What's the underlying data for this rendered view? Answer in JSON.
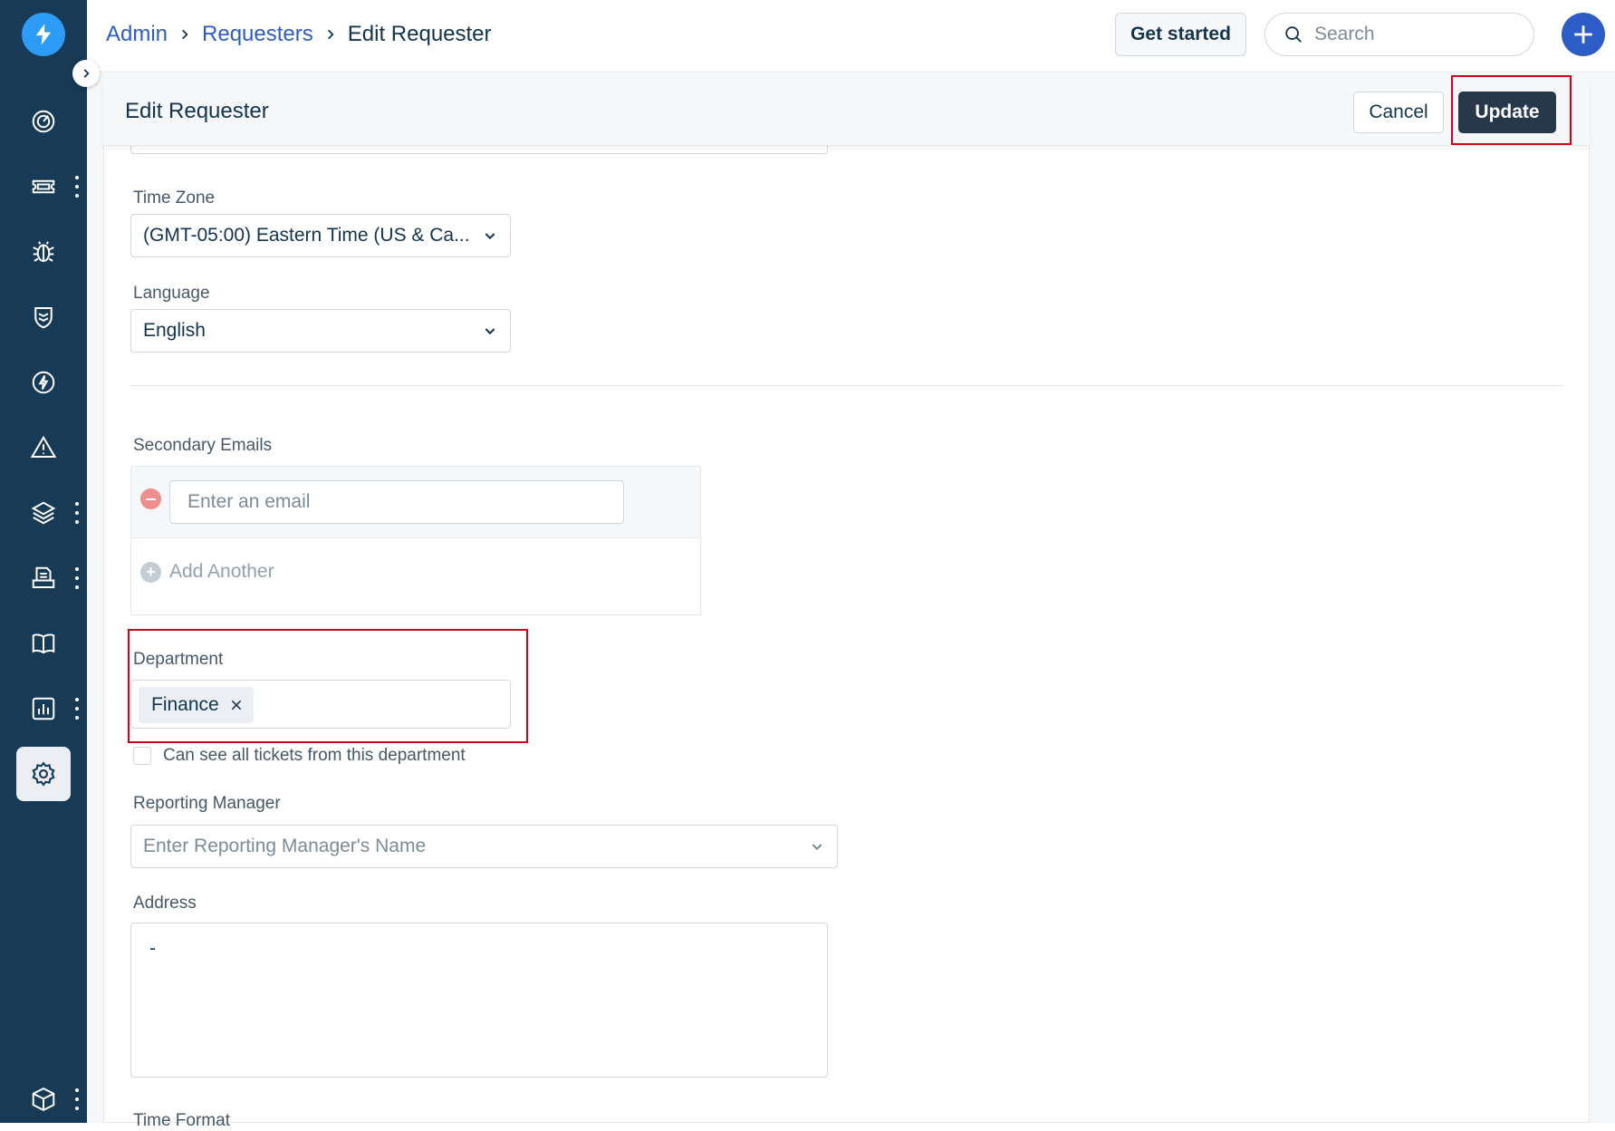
{
  "breadcrumb": {
    "admin": "Admin",
    "requesters": "Requesters",
    "current": "Edit Requester"
  },
  "header": {
    "get_started": "Get started",
    "search_placeholder": "Search"
  },
  "form": {
    "title": "Edit Requester",
    "cancel_label": "Cancel",
    "update_label": "Update",
    "time_zone": {
      "label": "Time Zone",
      "value": "(GMT-05:00) Eastern Time (US & Ca..."
    },
    "language": {
      "label": "Language",
      "value": "English"
    },
    "secondary_emails": {
      "label": "Secondary Emails",
      "placeholder": "Enter an email",
      "add_another": "Add Another"
    },
    "department": {
      "label": "Department",
      "chip": "Finance"
    },
    "see_all_tickets": "Can see all tickets from this department",
    "reporting_manager": {
      "label": "Reporting Manager",
      "placeholder": "Enter Reporting Manager's Name"
    },
    "address": {
      "label": "Address",
      "value": "-"
    },
    "time_format": {
      "label": "Time Format"
    }
  },
  "sidebar": {
    "items": [
      "dashboard-icon",
      "tickets-icon",
      "problems-icon",
      "changes-icon",
      "releases-icon",
      "alerts-icon",
      "assets-icon",
      "inventory-icon",
      "solutions-icon",
      "reports-icon",
      "admin-gear-icon",
      "apps-cube-icon"
    ],
    "active": "admin-gear-icon"
  },
  "colors": {
    "sidebar": "#173a57",
    "link": "#2c5cc5",
    "primary_button": "#263849",
    "highlight": "#d0021b"
  }
}
